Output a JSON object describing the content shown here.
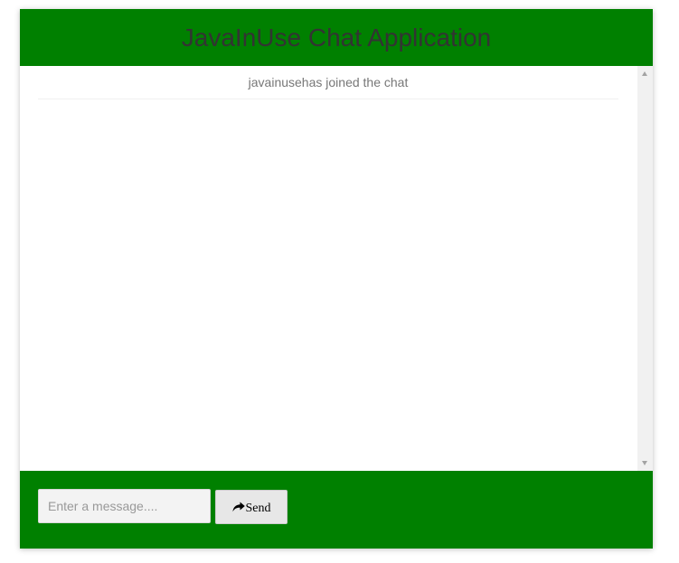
{
  "header": {
    "title": "JavaInUse Chat Application"
  },
  "messages": [
    {
      "type": "event",
      "text": "javainusehas joined the chat"
    }
  ],
  "form": {
    "placeholder": "Enter a message....",
    "value": "",
    "send_label": "Send",
    "send_icon": "share-arrow-icon"
  },
  "colors": {
    "header_bg": "#008000",
    "form_bg": "#008000",
    "title_text": "#333333",
    "event_text": "#777777"
  }
}
